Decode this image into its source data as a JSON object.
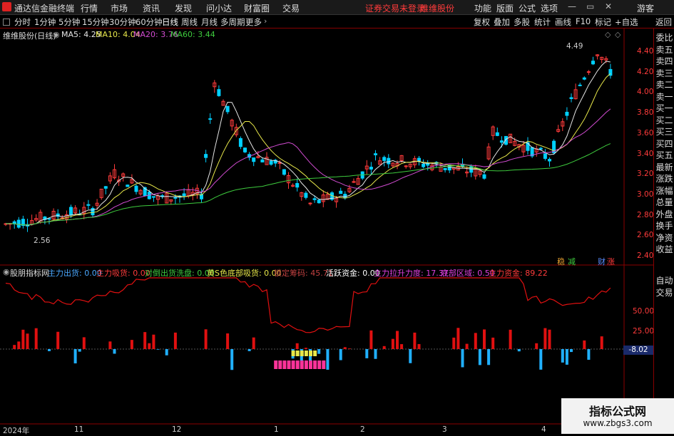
{
  "app": {
    "title": "通达信金融终端",
    "menus": [
      "行情",
      "市场",
      "资讯",
      "发现",
      "问小达",
      "财富圈",
      "交易"
    ],
    "status": "证券交易未登录",
    "stock": "维维股份",
    "window_menus": [
      "功能",
      "版面",
      "公式",
      "选项"
    ],
    "guest": "游客"
  },
  "timeframes": [
    "分时",
    "1分钟",
    "5分钟",
    "15分钟",
    "30分钟",
    "60分钟",
    "日线",
    "周线",
    "月线",
    "多周期",
    "更多"
  ],
  "active_timeframe": "日线",
  "toolbar_right": [
    "复权",
    "叠加",
    "多股",
    "统计",
    "画线",
    "F10",
    "标记",
    "+自选",
    "返回"
  ],
  "main_legend": {
    "title": "维维股份(日线)",
    "items": [
      {
        "text": "MA5: 4.25",
        "color": "#e6e6e6"
      },
      {
        "text": "MA10: 4.04",
        "color": "#e8e84a"
      },
      {
        "text": "MA20: 3.76",
        "color": "#d24cd2"
      },
      {
        "text": "MA60: 3.44",
        "color": "#3ecc3e"
      }
    ]
  },
  "price_axis": [
    "4.40",
    "4.20",
    "4.00",
    "3.80",
    "3.60",
    "3.40",
    "3.20",
    "3.00",
    "2.80",
    "2.60",
    "2.40"
  ],
  "annotations": {
    "high": "4.49",
    "low": "2.56"
  },
  "badges": [
    {
      "text": "稳",
      "color": "#e8a030"
    },
    {
      "text": "减",
      "color": "#3ecc3e"
    },
    {
      "text": "财",
      "color": "#5a8cff"
    },
    {
      "text": "涨",
      "color": "#ff3b3b"
    }
  ],
  "indicator_legend": [
    {
      "text": "股朋指标网",
      "color": "#dddddd"
    },
    {
      "text": "主力出货: 0.00",
      "color": "#4aa8ff"
    },
    {
      "text": "主力吸货: 0.00",
      "color": "#ff3b3b"
    },
    {
      "text": "对倒出货洗盘: 0.00",
      "color": "#3ecc3e"
    },
    {
      "text": "黄S色底部吸货: 0.00",
      "color": "#e8e84a"
    },
    {
      "text": "锁定筹码: 45.71",
      "color": "#c04040"
    },
    {
      "text": "活跃资金: 0.00",
      "color": "#ffffff"
    },
    {
      "text": "主力拉升力度: 17.37",
      "color": "#e040e0"
    },
    {
      "text": "底部区域: 0.50",
      "color": "#e040e0"
    },
    {
      "text": "主力资金: 89.22",
      "color": "#ff3b3b"
    }
  ],
  "indicator_axis": [
    "50.00",
    "25.00"
  ],
  "indicator_value": "-8.02",
  "date_axis": [
    "2024年",
    "11",
    "12",
    "1",
    "2",
    "3",
    "4"
  ],
  "side_panel": [
    "委比",
    "卖五",
    "卖四",
    "卖三",
    "卖二",
    "卖一",
    "买一",
    "买二",
    "买三",
    "买四",
    "买五",
    "最新",
    "涨跌",
    "涨幅",
    "总量",
    "外盘",
    "换手",
    "净资",
    "收益"
  ],
  "side_buttons": [
    "自动",
    "交易"
  ],
  "watermark": {
    "line1": "指标公式网",
    "line2": "www.zbgs3.com"
  },
  "colors": {
    "up": "#ff3b3b",
    "down": "#00d0ff",
    "grid": "#8b0000"
  }
}
